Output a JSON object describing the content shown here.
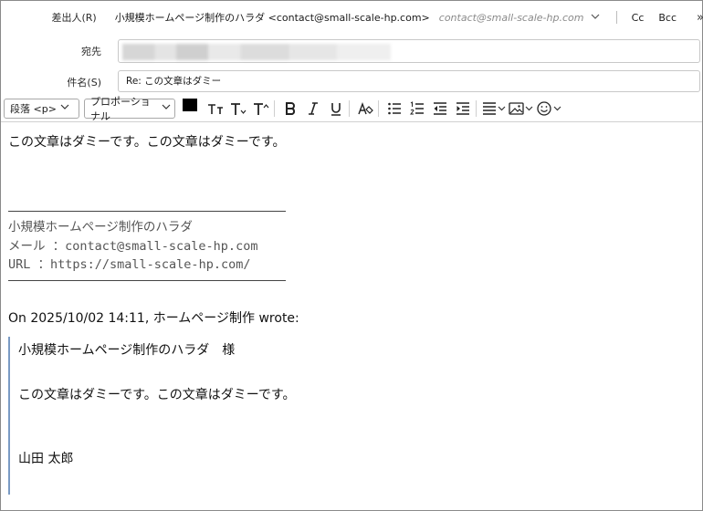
{
  "header": {
    "from_label": "差出人(R)",
    "from_name": "小規模ホームページ制作のハラダ <contact@small-scale-hp.com>",
    "from_address": "contact@small-scale-hp.com",
    "cc_label": "Cc",
    "bcc_label": "Bcc",
    "more_label": "»",
    "to_label": "宛先",
    "to_value_redacted": true,
    "subject_label": "件名(S)",
    "subject_value": "Re: この文章はダミー"
  },
  "toolbar": {
    "paragraph_select": "段落 <p>",
    "font_select": "プロポーショナル",
    "text_color": "#000000",
    "bg_color": "#ffffff"
  },
  "body": {
    "line1": "この文章はダミーです。この文章はダミーです。",
    "signature": {
      "name": "小規模ホームページ制作のハラダ",
      "mail": "メール ：contact@small-scale-hp.com",
      "url": "URL ：https://small-scale-hp.com/"
    },
    "reply_header": "On 2025/10/02 14:11, ホームページ制作 wrote:",
    "quote": {
      "salutation": "小規模ホームページ制作のハラダ　様",
      "text": "この文章はダミーです。この文章はダミーです。",
      "sender": "山田 太郎"
    }
  },
  "colors": {
    "quote_bar": "#7a9bc4",
    "border": "#8a8a8a"
  }
}
